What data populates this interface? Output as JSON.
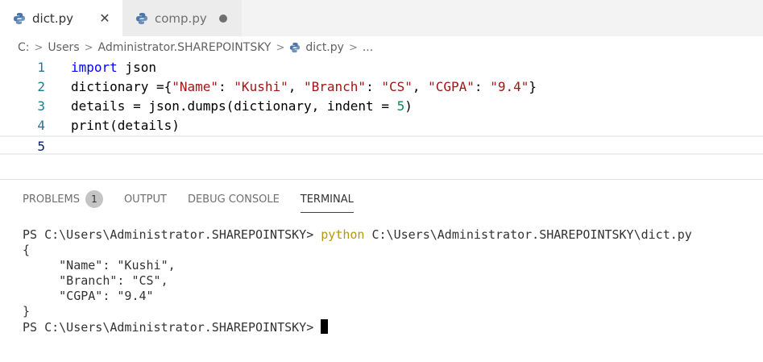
{
  "tabs": [
    {
      "label": "dict.py",
      "active": true,
      "status": "close"
    },
    {
      "label": "comp.py",
      "active": false,
      "status": "modified"
    }
  ],
  "breadcrumb": {
    "parts": [
      "C:",
      "Users",
      "Administrator.SHAREPOINTSKY"
    ],
    "file": "dict.py",
    "more": "..."
  },
  "editor": {
    "lines": [
      {
        "number": "1",
        "tokens": [
          {
            "t": "import",
            "c": "kw"
          },
          {
            "t": " json",
            "c": "plain"
          }
        ]
      },
      {
        "number": "2",
        "tokens": [
          {
            "t": "dictionary ={",
            "c": "plain"
          },
          {
            "t": "\"Name\"",
            "c": "str"
          },
          {
            "t": ": ",
            "c": "plain"
          },
          {
            "t": "\"Kushi\"",
            "c": "str"
          },
          {
            "t": ", ",
            "c": "plain"
          },
          {
            "t": "\"Branch\"",
            "c": "str"
          },
          {
            "t": ": ",
            "c": "plain"
          },
          {
            "t": "\"CS\"",
            "c": "str"
          },
          {
            "t": ", ",
            "c": "plain"
          },
          {
            "t": "\"CGPA\"",
            "c": "str"
          },
          {
            "t": ": ",
            "c": "plain"
          },
          {
            "t": "\"9.4\"",
            "c": "str"
          },
          {
            "t": "}",
            "c": "plain"
          }
        ]
      },
      {
        "number": "3",
        "tokens": [
          {
            "t": "details = json.dumps(dictionary, indent = ",
            "c": "plain"
          },
          {
            "t": "5",
            "c": "num"
          },
          {
            "t": ")",
            "c": "plain"
          }
        ]
      },
      {
        "number": "4",
        "tokens": [
          {
            "t": "print(details)",
            "c": "plain"
          }
        ]
      },
      {
        "number": "5",
        "tokens": []
      }
    ]
  },
  "panel": {
    "tabs": [
      {
        "label": "PROBLEMS",
        "badge": "1"
      },
      {
        "label": "OUTPUT"
      },
      {
        "label": "DEBUG CONSOLE"
      },
      {
        "label": "TERMINAL",
        "active": true
      }
    ]
  },
  "terminal": {
    "prompt_line": {
      "prompt": "PS C:\\Users\\Administrator.SHAREPOINTSKY> ",
      "command": "python",
      "args": " C:\\Users\\Administrator.SHAREPOINTSKY\\dict.py"
    },
    "output": [
      "{",
      "     \"Name\": \"Kushi\",",
      "     \"Branch\": \"CS\",",
      "     \"CGPA\": \"9.4\"",
      "}"
    ],
    "final_prompt": "PS C:\\Users\\Administrator.SHAREPOINTSKY> "
  }
}
